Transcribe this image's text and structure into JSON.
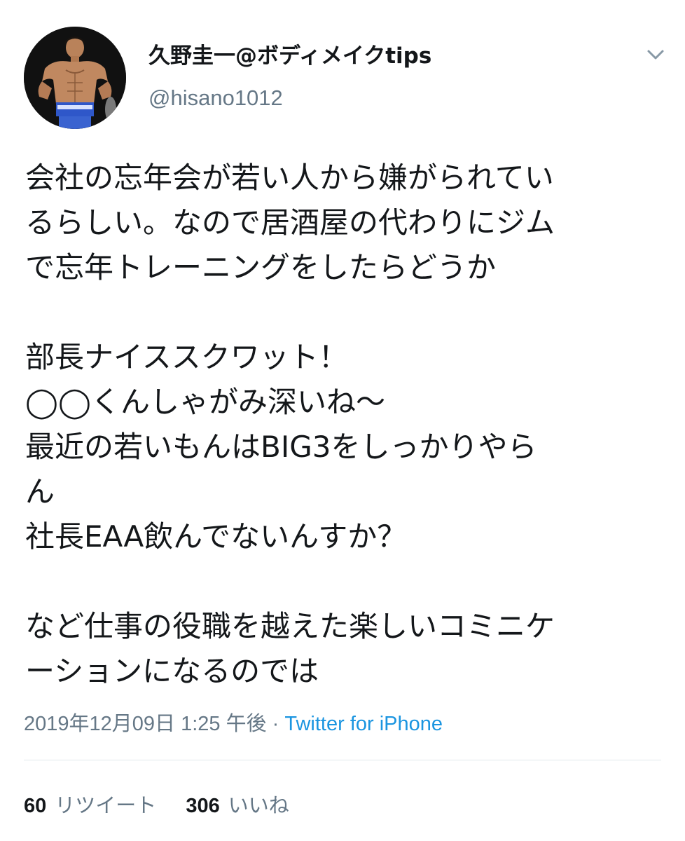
{
  "author": {
    "display_name": "久野圭一@ボディメイクtips",
    "handle": "@hisano1012"
  },
  "icons": {
    "avatar": "profile-photo",
    "menu": "chevron-down-icon"
  },
  "tweet": {
    "paragraphs": [
      [
        "会社の忘年会が若い人から嫌がられてい",
        "るらしい。なので居酒屋の代わりにジム",
        "で忘年トレーニングをしたらどうか"
      ],
      [
        "部長ナイススクワット！",
        "◯◯くんしゃがみ深いね〜",
        "最近の若いもんはBIG3をしっかりやら",
        "ん",
        "社長EAA飲んでないんすか？"
      ],
      [
        "など仕事の役職を越えた楽しいコミニケ",
        "ーションになるのでは"
      ]
    ]
  },
  "meta": {
    "timestamp": "2019年12月09日 1:25 午後",
    "separator": " · ",
    "source": "Twitter for iPhone"
  },
  "stats": {
    "retweets_count": "60",
    "retweets_label": "リツイート",
    "likes_count": "306",
    "likes_label": "いいね"
  },
  "colors": {
    "text": "#14171a",
    "secondary": "#657786",
    "link": "#1b95e0",
    "divider": "#e1e8ed"
  }
}
